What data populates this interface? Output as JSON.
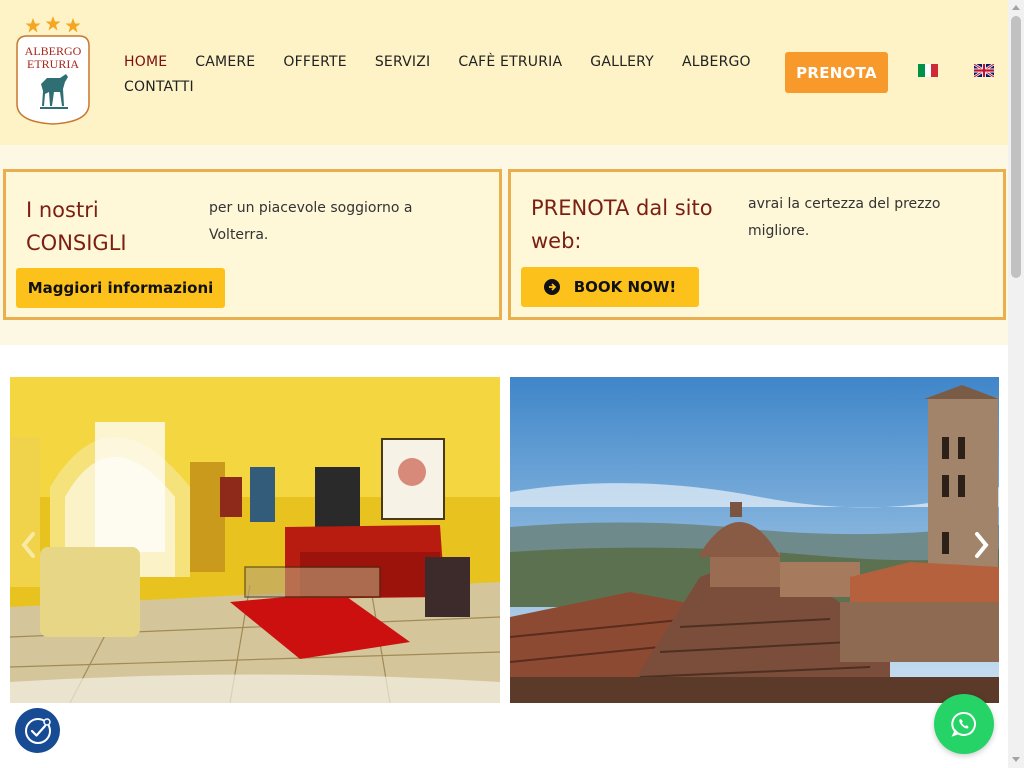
{
  "logo": {
    "line1": "ALBERGO",
    "line2": "ETRURIA",
    "stars": 3
  },
  "nav": {
    "row1": [
      "HOME",
      "CAMERE",
      "OFFERTE",
      "SERVIZI",
      "CAFÈ ETRURIA",
      "GALLERY",
      "ALBERGO"
    ],
    "row2": [
      "CONTATTI"
    ],
    "active": "HOME"
  },
  "header": {
    "book_label": "PRENOTA"
  },
  "languages": [
    "italian-flag",
    "english-flag"
  ],
  "box1": {
    "title_line1": "I nostri",
    "title_line2": "CONSIGLI",
    "text_line1": "per un piacevole soggiorno a",
    "text_line2": "Volterra.",
    "button": "Maggiori informazioni"
  },
  "box2": {
    "title_line1": "PRENOTA dal sito",
    "title_line2": "web:",
    "text_line1": "avrai la certezza del prezzo",
    "text_line2": "migliore.",
    "button": "BOOK NOW!"
  },
  "slider": {
    "slides": [
      "hotel-lounge-photo",
      "volterra-rooftops-photo"
    ]
  },
  "colors": {
    "header_bg": "#fdf3c6",
    "accent_orange": "#f79a2b",
    "accent_yellow": "#fcc11b",
    "box_border": "#e9ae4d",
    "title_red": "#7a1f12",
    "whatsapp_green": "#25d366",
    "cookie_blue": "#174b93"
  }
}
